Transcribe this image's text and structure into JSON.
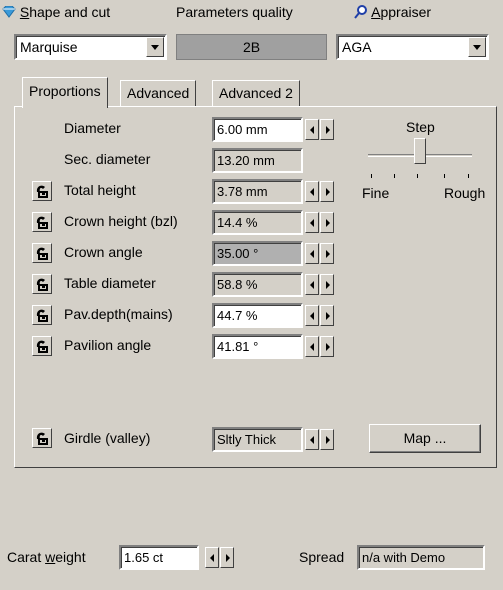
{
  "header": {
    "shape_label": "Shape and cut",
    "shape_label_ul": "S",
    "shape_value": "Marquise",
    "quality_label": "Parameters quality",
    "quality_value": "2B",
    "appraiser_label": "Appraiser",
    "appraiser_label_ul": "A",
    "appraiser_value": "AGA"
  },
  "tabs": [
    {
      "label": "Proportions",
      "active": true
    },
    {
      "label": "Advanced",
      "active": false
    },
    {
      "label": "Advanced 2",
      "active": false
    }
  ],
  "rows": [
    {
      "label": "Diameter",
      "value": "6.00 mm",
      "lock": false,
      "spin": true
    },
    {
      "label": "Sec. diameter",
      "value": "13.20 mm",
      "lock": false,
      "spin": false
    },
    {
      "label": "Total height",
      "value": "3.78 mm",
      "lock": true,
      "spin": true
    },
    {
      "label": "Crown height (bzl)",
      "value": "14.4 %",
      "lock": true,
      "spin": true
    },
    {
      "label": "Crown angle",
      "value": "35.00 °",
      "lock": true,
      "spin": true
    },
    {
      "label": "Table diameter",
      "value": "58.8 %",
      "lock": true,
      "spin": true
    },
    {
      "label": "Pav.depth(mains)",
      "value": "44.7 %",
      "lock": true,
      "spin": true
    },
    {
      "label": "Pavilion angle",
      "value": "41.81 °",
      "lock": true,
      "spin": true
    }
  ],
  "girdle": {
    "label": "Girdle (valley)",
    "value": "Sltly Thick"
  },
  "step": {
    "title": "Step",
    "min_label": "Fine",
    "max_label": "Rough",
    "level": 0.5
  },
  "map_button": "Map ...",
  "footer": {
    "carat_label_pre": "Carat ",
    "carat_label_ul": "w",
    "carat_label_post": "eight",
    "carat_value": "1.65 ct",
    "spread_label": "Spread",
    "spread_value": "n/a with Demo"
  },
  "colors": {
    "gem_icon": "#3a9ad9",
    "lock_icon": "#000000"
  }
}
